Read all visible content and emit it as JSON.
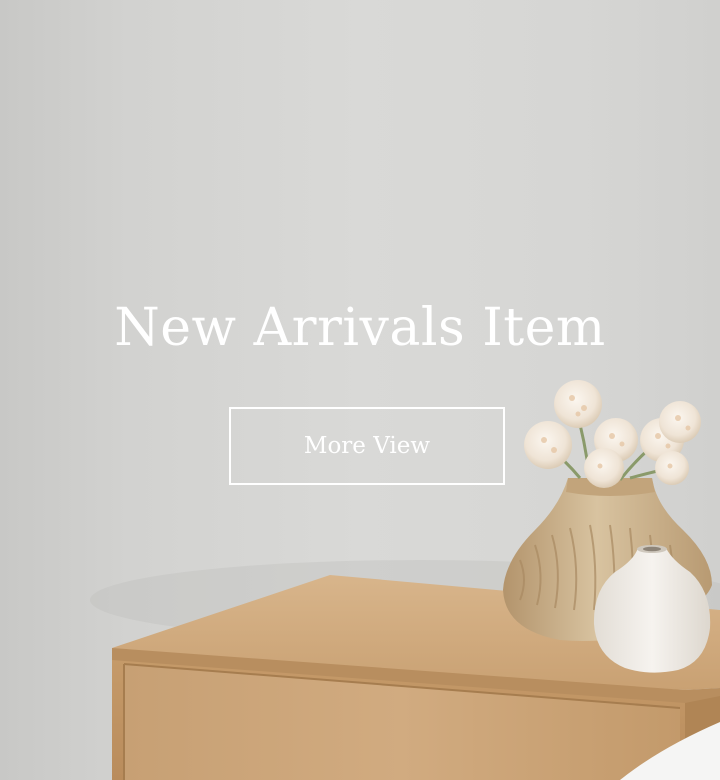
{
  "hero": {
    "title": "New Arrivals Item",
    "button_label": "More View"
  },
  "colors": {
    "wall": "#d6d6d4",
    "text": "#ffffff",
    "wood": "#c9a57a",
    "vase_tan": "#c8ab83",
    "vase_white": "#efebe6"
  }
}
